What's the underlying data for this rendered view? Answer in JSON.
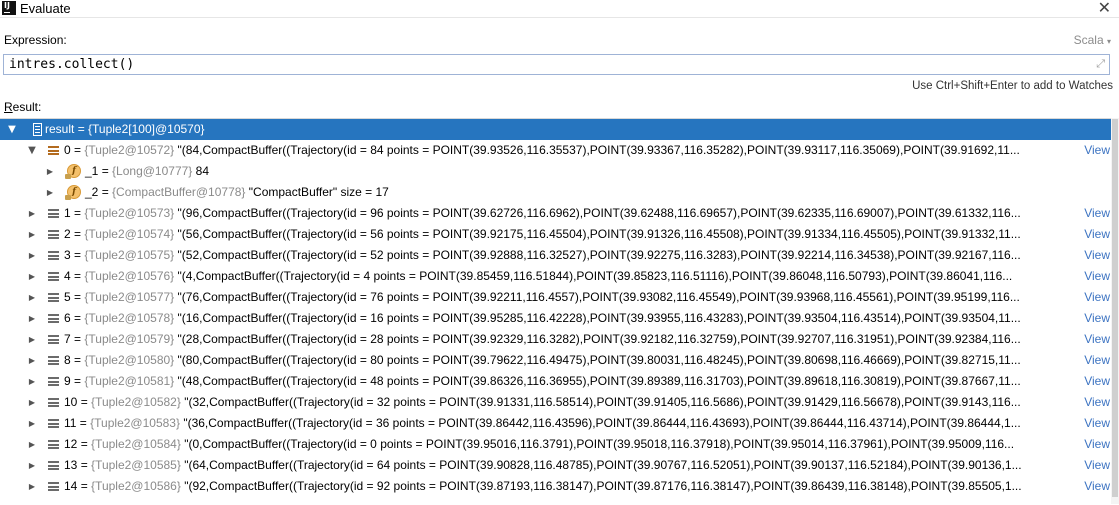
{
  "window": {
    "title": "Evaluate"
  },
  "expression": {
    "label": "Expression:",
    "language": "Scala",
    "value": "intres.collect()",
    "hint": "Use Ctrl+Shift+Enter to add to Watches"
  },
  "result": {
    "label_underlined": "R",
    "label_rest": "esult:",
    "root": {
      "name": "result",
      "value": "= {Tuple2[100]@10570}"
    },
    "view_label": "View",
    "rows": [
      {
        "name": "0",
        "ref": "{Tuple2@10572}",
        "text": "\"(84,CompactBuffer((Trajectory(id = 84 points = POINT(39.93526,116.35537),POINT(39.93367,116.35282),POINT(39.93117,116.35069),POINT(39.91692,11..."
      },
      {
        "name": "1",
        "ref": "{Tuple2@10573}",
        "text": "\"(96,CompactBuffer((Trajectory(id = 96 points = POINT(39.62726,116.6962),POINT(39.62488,116.69657),POINT(39.62335,116.69007),POINT(39.61332,116..."
      },
      {
        "name": "2",
        "ref": "{Tuple2@10574}",
        "text": "\"(56,CompactBuffer((Trajectory(id = 56 points = POINT(39.92175,116.45504),POINT(39.91326,116.45508),POINT(39.91334,116.45505),POINT(39.91332,11..."
      },
      {
        "name": "3",
        "ref": "{Tuple2@10575}",
        "text": "\"(52,CompactBuffer((Trajectory(id = 52 points = POINT(39.92888,116.32527),POINT(39.92275,116.3283),POINT(39.92214,116.34538),POINT(39.92167,116..."
      },
      {
        "name": "4",
        "ref": "{Tuple2@10576}",
        "text": "\"(4,CompactBuffer((Trajectory(id = 4 points = POINT(39.85459,116.51844),POINT(39.85823,116.51116),POINT(39.86048,116.50793),POINT(39.86041,116..."
      },
      {
        "name": "5",
        "ref": "{Tuple2@10577}",
        "text": "\"(76,CompactBuffer((Trajectory(id = 76 points = POINT(39.92211,116.4557),POINT(39.93082,116.45549),POINT(39.93968,116.45561),POINT(39.95199,116..."
      },
      {
        "name": "6",
        "ref": "{Tuple2@10578}",
        "text": "\"(16,CompactBuffer((Trajectory(id = 16 points = POINT(39.95285,116.42228),POINT(39.93955,116.43283),POINT(39.93504,116.43514),POINT(39.93504,11..."
      },
      {
        "name": "7",
        "ref": "{Tuple2@10579}",
        "text": "\"(28,CompactBuffer((Trajectory(id = 28 points = POINT(39.92329,116.3282),POINT(39.92182,116.32759),POINT(39.92707,116.31951),POINT(39.92384,116..."
      },
      {
        "name": "8",
        "ref": "{Tuple2@10580}",
        "text": "\"(80,CompactBuffer((Trajectory(id = 80 points = POINT(39.79622,116.49475),POINT(39.80031,116.48245),POINT(39.80698,116.46669),POINT(39.82715,11..."
      },
      {
        "name": "9",
        "ref": "{Tuple2@10581}",
        "text": "\"(48,CompactBuffer((Trajectory(id = 48 points = POINT(39.86326,116.36955),POINT(39.89389,116.31703),POINT(39.89618,116.30819),POINT(39.87667,11..."
      },
      {
        "name": "10",
        "ref": "{Tuple2@10582}",
        "text": "\"(32,CompactBuffer((Trajectory(id = 32 points = POINT(39.91331,116.58514),POINT(39.91405,116.5686),POINT(39.91429,116.56678),POINT(39.9143,116..."
      },
      {
        "name": "11",
        "ref": "{Tuple2@10583}",
        "text": "\"(36,CompactBuffer((Trajectory(id = 36 points = POINT(39.86442,116.43596),POINT(39.86444,116.43693),POINT(39.86444,116.43714),POINT(39.86444,1..."
      },
      {
        "name": "12",
        "ref": "{Tuple2@10584}",
        "text": "\"(0,CompactBuffer((Trajectory(id = 0 points = POINT(39.95016,116.3791),POINT(39.95018,116.37918),POINT(39.95014,116.37961),POINT(39.95009,116..."
      },
      {
        "name": "13",
        "ref": "{Tuple2@10585}",
        "text": "\"(64,CompactBuffer((Trajectory(id = 64 points = POINT(39.90828,116.48785),POINT(39.90767,116.52051),POINT(39.90137,116.52184),POINT(39.90136,1..."
      },
      {
        "name": "14",
        "ref": "{Tuple2@10586}",
        "text": "\"(92,CompactBuffer((Trajectory(id = 92 points = POINT(39.87193,116.38147),POINT(39.87176,116.38147),POINT(39.86439,116.38148),POINT(39.85505,1..."
      }
    ],
    "children": [
      {
        "name": "_1",
        "ref": "{Long@10777}",
        "text": "84"
      },
      {
        "name": "_2",
        "ref": "{CompactBuffer@10778}",
        "text": "\"CompactBuffer\" size = 17"
      }
    ]
  }
}
